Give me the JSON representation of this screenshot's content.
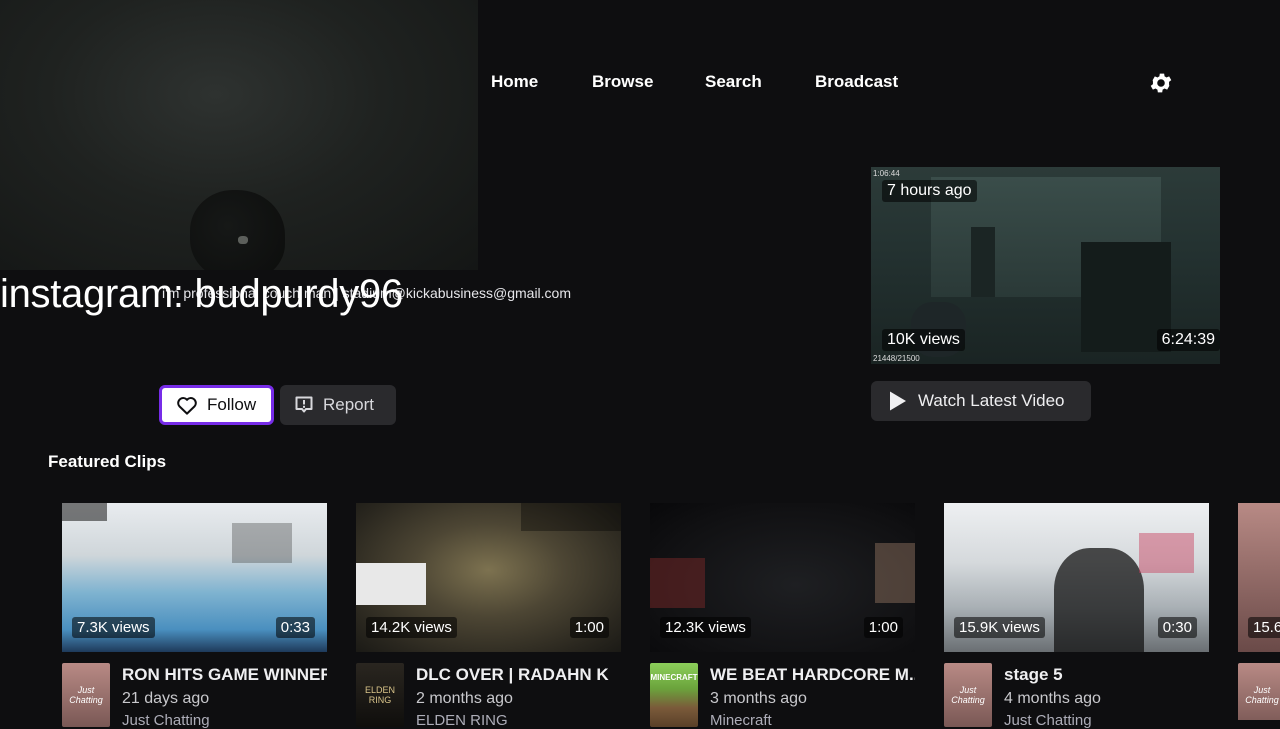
{
  "nav": {
    "items": [
      "Home",
      "Browse",
      "Search",
      "Broadcast"
    ],
    "settings_icon": "gear-icon"
  },
  "channel": {
    "title": "instagram: budpurdy96",
    "bio": "i'm professional couch man | stadium@kickabusiness@gmail.com",
    "follow_label": "Follow",
    "report_label": "Report"
  },
  "latest_video": {
    "age": "7 hours ago",
    "views": "10K views",
    "duration": "6:24:39",
    "hud_top": "1:06:44",
    "hud_bottom": "21448/21500",
    "watch_label": "Watch Latest Video"
  },
  "featured": {
    "title": "Featured Clips",
    "clips": [
      {
        "views": "7.3K views",
        "duration": "0:33",
        "title": "RON HITS GAME WINNER",
        "date": "21 days ago",
        "category": "Just Chatting",
        "avatar_text": "Just Chatting"
      },
      {
        "views": "14.2K views",
        "duration": "1:00",
        "title": "DLC OVER | RADAHN K",
        "date": "2 months ago",
        "category": "ELDEN RING",
        "avatar_text": "ELDEN RING"
      },
      {
        "views": "12.3K views",
        "duration": "1:00",
        "title": "WE BEAT HARDCORE M...",
        "date": "3 months ago",
        "category": "Minecraft",
        "avatar_text": "MINECRAFT"
      },
      {
        "views": "15.9K views",
        "duration": "0:30",
        "title": "stage 5",
        "date": "4 months ago",
        "category": "Just Chatting",
        "avatar_text": "Just Chatting"
      },
      {
        "views": "15.6",
        "duration": "",
        "title": "",
        "date": "",
        "category": "",
        "avatar_text": "Just Chatting"
      }
    ]
  }
}
